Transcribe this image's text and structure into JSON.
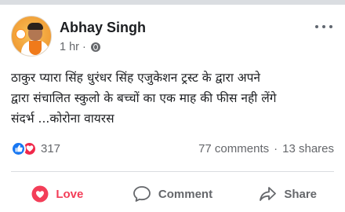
{
  "post": {
    "author": "Abhay Singh",
    "timestamp": "1 hr",
    "separator": "·",
    "privacy_icon": "globe-icon",
    "text_lines": [
      "ठाकुर प्यारा सिंह धुरंधर सिंह  एजुकेशन ट्रस्ट के  द्वारा अपने",
      "द्वारा संचालित स्कुलो के बच्चों का एक माह की फीस नही लेंगे",
      "संदर्भ ...कोरोना वायरस"
    ],
    "reactions": {
      "count": "317",
      "icons": [
        "like-icon",
        "love-icon"
      ]
    },
    "comments": "77 comments",
    "dot": "·",
    "shares": "13 shares"
  },
  "actions": {
    "love_label": "Love",
    "comment_label": "Comment",
    "share_label": "Share"
  },
  "colors": {
    "love": "#f33e58",
    "like": "#1877f2",
    "muted": "#65676b",
    "text": "#1c1e21"
  }
}
